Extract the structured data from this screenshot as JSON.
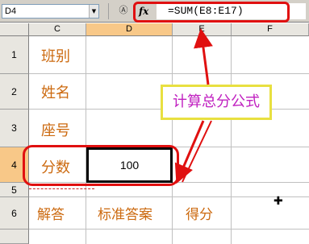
{
  "formula_bar": {
    "name_box": "D4",
    "formula": "=SUM(E8:E17)",
    "fx_label": "fx",
    "icon_name": "cancel-icon"
  },
  "columns": [
    {
      "label": "C",
      "active": false
    },
    {
      "label": "D",
      "active": true
    },
    {
      "label": "E",
      "active": false
    },
    {
      "label": "F",
      "active": false
    }
  ],
  "rows": [
    {
      "label": "1",
      "active": false
    },
    {
      "label": "2",
      "active": false
    },
    {
      "label": "3",
      "active": false
    },
    {
      "label": "4",
      "active": true
    },
    {
      "label": "5",
      "active": false
    },
    {
      "label": "6",
      "active": false
    }
  ],
  "cells": {
    "c1": "班别",
    "c2": "姓名",
    "c3": "座号",
    "c4": "分数",
    "d4": "100",
    "c6": "解答",
    "d6": "标准答案",
    "e6": "得分"
  },
  "annotation": {
    "text": "计算总分公式"
  },
  "colors": {
    "label_orange": "#cc6a10",
    "highlight_red": "#e01010",
    "annotation_magenta": "#c020c0",
    "annotation_border": "#e8e040",
    "active_header": "#f8c888"
  },
  "cursor": "plus-cursor-icon"
}
